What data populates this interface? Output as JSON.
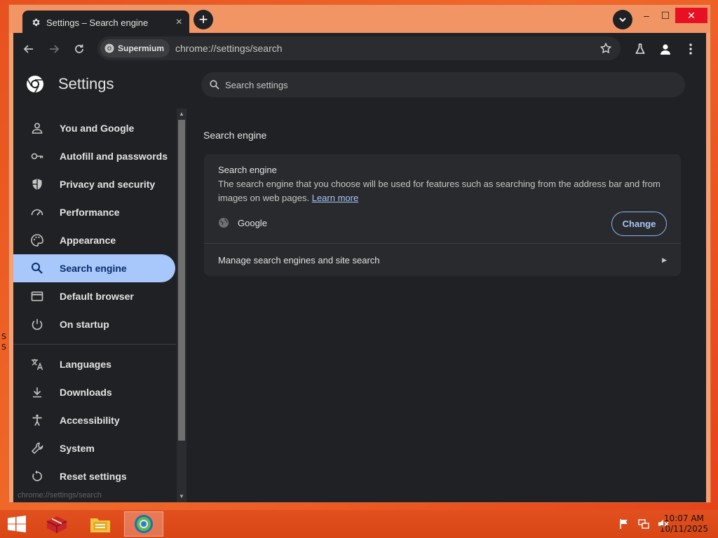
{
  "tab": {
    "title": "Settings – Search engine",
    "close": "×"
  },
  "new_tab": "+",
  "window": {
    "minimize": "–",
    "maximize": "☐",
    "close": "✕"
  },
  "omnibox": {
    "chip": "Supermium",
    "url": "chrome://settings/search"
  },
  "settings": {
    "title": "Settings",
    "search_placeholder": "Search settings"
  },
  "nav": {
    "items": [
      {
        "label": "You and Google",
        "icon": "person-icon"
      },
      {
        "label": "Autofill and passwords",
        "icon": "key-icon"
      },
      {
        "label": "Privacy and security",
        "icon": "shield-icon"
      },
      {
        "label": "Performance",
        "icon": "speedometer-icon"
      },
      {
        "label": "Appearance",
        "icon": "palette-icon"
      },
      {
        "label": "Search engine",
        "icon": "search-icon",
        "active": true
      },
      {
        "label": "Default browser",
        "icon": "browser-icon"
      },
      {
        "label": "On startup",
        "icon": "power-icon"
      },
      {
        "label": "Languages",
        "icon": "translate-icon"
      },
      {
        "label": "Downloads",
        "icon": "download-icon"
      },
      {
        "label": "Accessibility",
        "icon": "accessibility-icon"
      },
      {
        "label": "System",
        "icon": "wrench-icon"
      },
      {
        "label": "Reset settings",
        "icon": "reset-icon"
      }
    ]
  },
  "status_url": "chrome://settings/search",
  "main": {
    "section_title": "Search engine",
    "card_title": "Search engine",
    "description": "The search engine that you choose will be used for features such as searching from the address bar and from images on web pages.",
    "learn_more": "Learn more",
    "engine": "Google",
    "change": "Change",
    "manage": "Manage search engines and site search"
  },
  "taskbar": {
    "time": "10:07 AM",
    "date": "10/11/2025"
  },
  "desktop_glyphs": [
    "S",
    "S"
  ],
  "colors": {
    "accent": "#a8c7fa",
    "background": "#202124",
    "card": "#292a2d",
    "desktop": "#e8511f"
  }
}
